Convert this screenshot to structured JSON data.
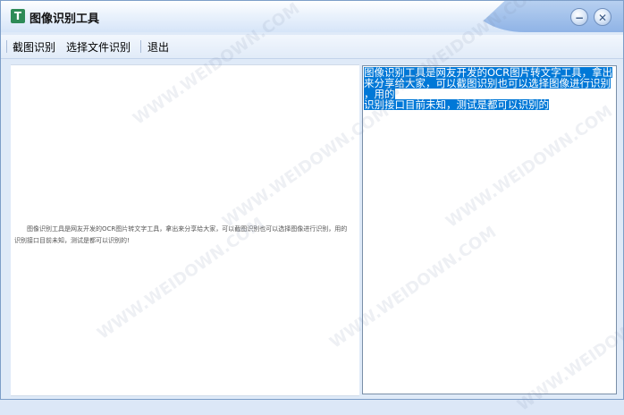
{
  "window": {
    "title": "图像识别工具",
    "app_icon_letter": "T",
    "minimize_glyph": "−",
    "close_glyph": "✕"
  },
  "menu": {
    "items": [
      "截图识别",
      "选择文件识别",
      "退出"
    ]
  },
  "left_pane": {
    "lines": [
      "图像识别工具是网友开发的OCR图片转文字工具，拿出来分享给大家，可以截图识别也可以选择图像进行识别，用的",
      "识别接口目前未知，测试是都可以识别的!"
    ]
  },
  "right_pane": {
    "lines": [
      "图像识别工具是网友开发的OCR图片转文字工具，拿出",
      "来分享给大家，可以截图识别也可以选择图像进行识别",
      "，用的",
      "识别接口目前未知，测试是都可以识别的"
    ]
  },
  "watermark_text": "WWW.WEIDOWN.COM",
  "colors": {
    "selection": "#0078d7",
    "title_bar_accent": "#8fb3e6"
  }
}
